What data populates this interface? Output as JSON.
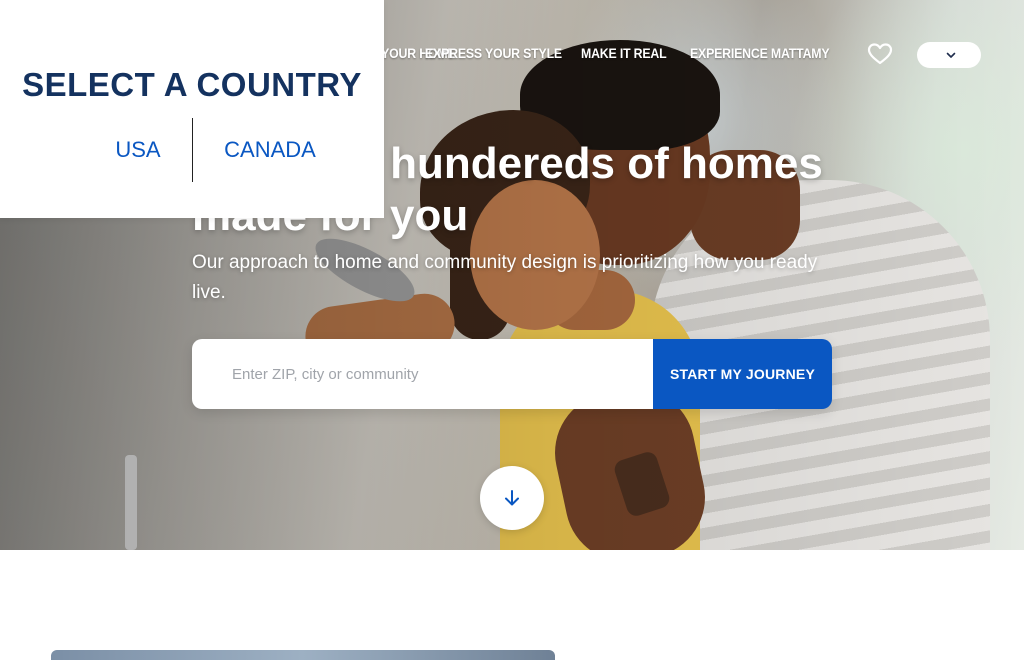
{
  "nav": {
    "items": [
      {
        "label": "Find your home",
        "left": 0
      },
      {
        "label": "Express your style"
      },
      {
        "label": "Make it real"
      },
      {
        "label": "Experience Mattamy"
      }
    ]
  },
  "hero": {
    "headline": "Discover hundereds of homes made for you",
    "subtitle": "Our approach to home and community design is prioritizing how you ready live."
  },
  "search": {
    "placeholder": "Enter ZIP, city or community",
    "button_label": "Start my journey"
  },
  "country_selector": {
    "title": "SELECT A COUNTRY",
    "options": [
      "USA",
      "CANADA"
    ]
  },
  "colors": {
    "primary_blue": "#0a57c2",
    "navy": "#14325f"
  },
  "icons": {
    "favorites": "heart-icon",
    "dropdown": "chevron-down-icon",
    "scroll": "arrow-down-icon"
  }
}
